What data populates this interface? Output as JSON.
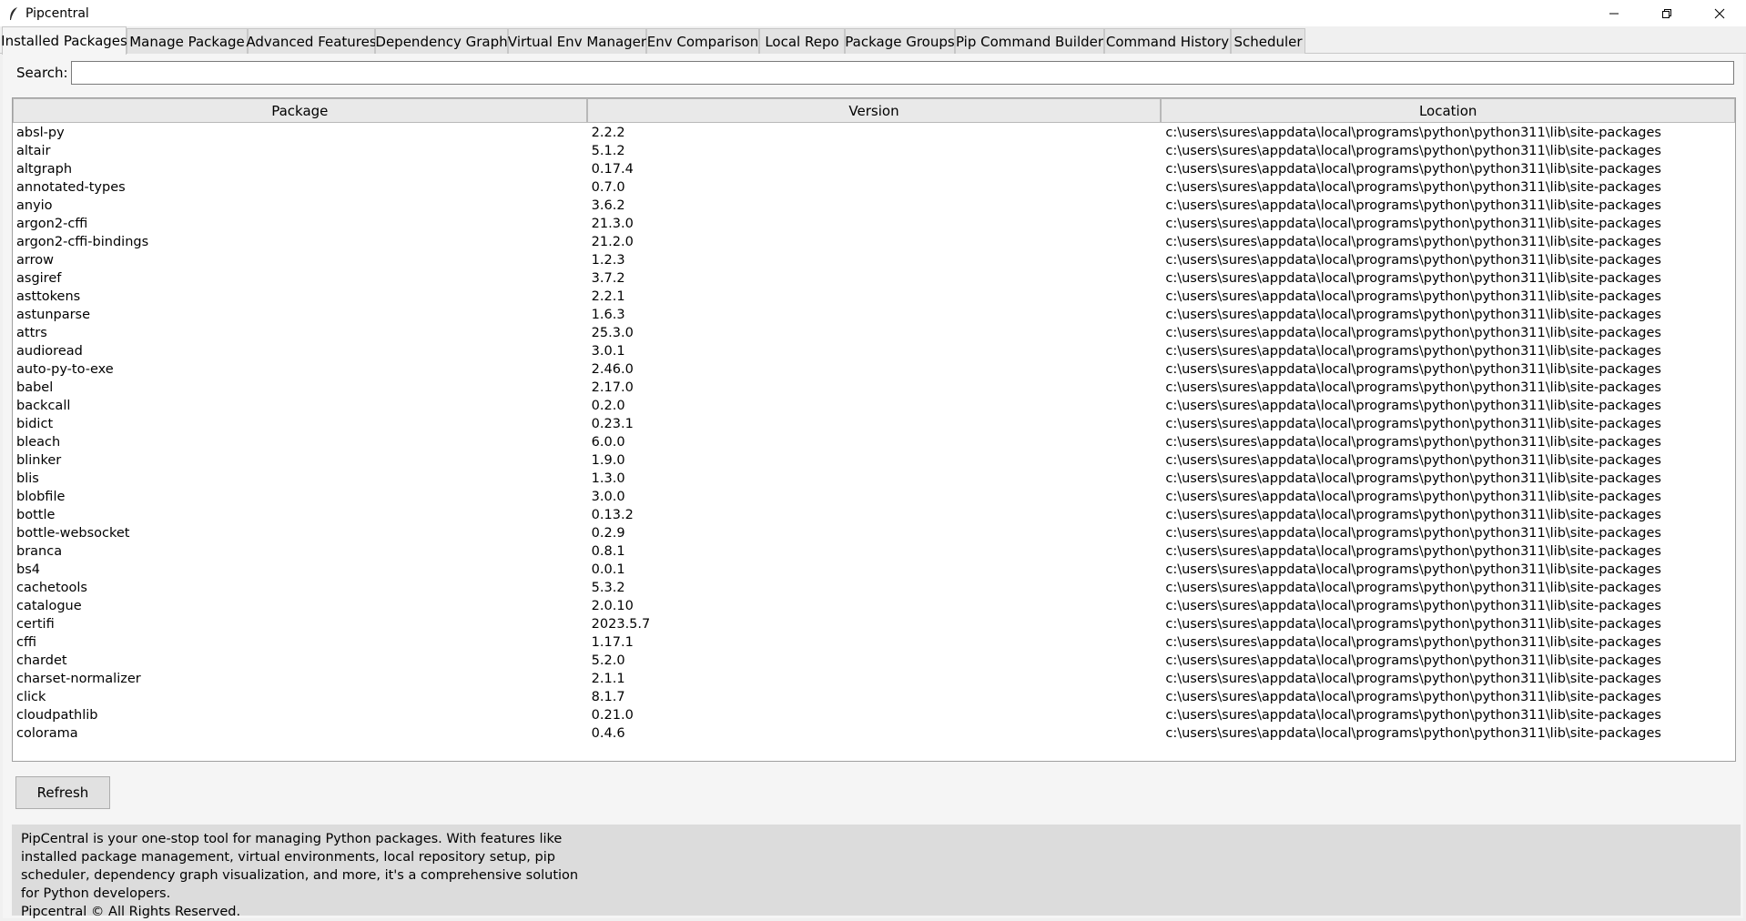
{
  "window": {
    "title": "Pipcentral",
    "controls": [
      "minimize-icon",
      "restore-icon",
      "close-icon"
    ]
  },
  "tabs": [
    {
      "label": "Installed Packages",
      "active": true
    },
    {
      "label": "Manage Package"
    },
    {
      "label": "Advanced Features"
    },
    {
      "label": "Dependency Graph"
    },
    {
      "label": "Virtual Env Manager"
    },
    {
      "label": "Env Comparison"
    },
    {
      "label": "Local Repo"
    },
    {
      "label": "Package Groups"
    },
    {
      "label": "Pip Command Builder"
    },
    {
      "label": "Command History"
    },
    {
      "label": "Scheduler"
    }
  ],
  "search": {
    "label": "Search:",
    "value": "",
    "placeholder": ""
  },
  "table": {
    "columns": [
      "Package",
      "Version",
      "Location"
    ],
    "rows": [
      [
        "absl-py",
        "2.2.2",
        "c:\\users\\sures\\appdata\\local\\programs\\python\\python311\\lib\\site-packages"
      ],
      [
        "altair",
        "5.1.2",
        "c:\\users\\sures\\appdata\\local\\programs\\python\\python311\\lib\\site-packages"
      ],
      [
        "altgraph",
        "0.17.4",
        "c:\\users\\sures\\appdata\\local\\programs\\python\\python311\\lib\\site-packages"
      ],
      [
        "annotated-types",
        "0.7.0",
        "c:\\users\\sures\\appdata\\local\\programs\\python\\python311\\lib\\site-packages"
      ],
      [
        "anyio",
        "3.6.2",
        "c:\\users\\sures\\appdata\\local\\programs\\python\\python311\\lib\\site-packages"
      ],
      [
        "argon2-cffi",
        "21.3.0",
        "c:\\users\\sures\\appdata\\local\\programs\\python\\python311\\lib\\site-packages"
      ],
      [
        "argon2-cffi-bindings",
        "21.2.0",
        "c:\\users\\sures\\appdata\\local\\programs\\python\\python311\\lib\\site-packages"
      ],
      [
        "arrow",
        "1.2.3",
        "c:\\users\\sures\\appdata\\local\\programs\\python\\python311\\lib\\site-packages"
      ],
      [
        "asgiref",
        "3.7.2",
        "c:\\users\\sures\\appdata\\local\\programs\\python\\python311\\lib\\site-packages"
      ],
      [
        "asttokens",
        "2.2.1",
        "c:\\users\\sures\\appdata\\local\\programs\\python\\python311\\lib\\site-packages"
      ],
      [
        "astunparse",
        "1.6.3",
        "c:\\users\\sures\\appdata\\local\\programs\\python\\python311\\lib\\site-packages"
      ],
      [
        "attrs",
        "25.3.0",
        "c:\\users\\sures\\appdata\\local\\programs\\python\\python311\\lib\\site-packages"
      ],
      [
        "audioread",
        "3.0.1",
        "c:\\users\\sures\\appdata\\local\\programs\\python\\python311\\lib\\site-packages"
      ],
      [
        "auto-py-to-exe",
        "2.46.0",
        "c:\\users\\sures\\appdata\\local\\programs\\python\\python311\\lib\\site-packages"
      ],
      [
        "babel",
        "2.17.0",
        "c:\\users\\sures\\appdata\\local\\programs\\python\\python311\\lib\\site-packages"
      ],
      [
        "backcall",
        "0.2.0",
        "c:\\users\\sures\\appdata\\local\\programs\\python\\python311\\lib\\site-packages"
      ],
      [
        "bidict",
        "0.23.1",
        "c:\\users\\sures\\appdata\\local\\programs\\python\\python311\\lib\\site-packages"
      ],
      [
        "bleach",
        "6.0.0",
        "c:\\users\\sures\\appdata\\local\\programs\\python\\python311\\lib\\site-packages"
      ],
      [
        "blinker",
        "1.9.0",
        "c:\\users\\sures\\appdata\\local\\programs\\python\\python311\\lib\\site-packages"
      ],
      [
        "blis",
        "1.3.0",
        "c:\\users\\sures\\appdata\\local\\programs\\python\\python311\\lib\\site-packages"
      ],
      [
        "blobfile",
        "3.0.0",
        "c:\\users\\sures\\appdata\\local\\programs\\python\\python311\\lib\\site-packages"
      ],
      [
        "bottle",
        "0.13.2",
        "c:\\users\\sures\\appdata\\local\\programs\\python\\python311\\lib\\site-packages"
      ],
      [
        "bottle-websocket",
        "0.2.9",
        "c:\\users\\sures\\appdata\\local\\programs\\python\\python311\\lib\\site-packages"
      ],
      [
        "branca",
        "0.8.1",
        "c:\\users\\sures\\appdata\\local\\programs\\python\\python311\\lib\\site-packages"
      ],
      [
        "bs4",
        "0.0.1",
        "c:\\users\\sures\\appdata\\local\\programs\\python\\python311\\lib\\site-packages"
      ],
      [
        "cachetools",
        "5.3.2",
        "c:\\users\\sures\\appdata\\local\\programs\\python\\python311\\lib\\site-packages"
      ],
      [
        "catalogue",
        "2.0.10",
        "c:\\users\\sures\\appdata\\local\\programs\\python\\python311\\lib\\site-packages"
      ],
      [
        "certifi",
        "2023.5.7",
        "c:\\users\\sures\\appdata\\local\\programs\\python\\python311\\lib\\site-packages"
      ],
      [
        "cffi",
        "1.17.1",
        "c:\\users\\sures\\appdata\\local\\programs\\python\\python311\\lib\\site-packages"
      ],
      [
        "chardet",
        "5.2.0",
        "c:\\users\\sures\\appdata\\local\\programs\\python\\python311\\lib\\site-packages"
      ],
      [
        "charset-normalizer",
        "2.1.1",
        "c:\\users\\sures\\appdata\\local\\programs\\python\\python311\\lib\\site-packages"
      ],
      [
        "click",
        "8.1.7",
        "c:\\users\\sures\\appdata\\local\\programs\\python\\python311\\lib\\site-packages"
      ],
      [
        "cloudpathlib",
        "0.21.0",
        "c:\\users\\sures\\appdata\\local\\programs\\python\\python311\\lib\\site-packages"
      ],
      [
        "colorama",
        "0.4.6",
        "c:\\users\\sures\\appdata\\local\\programs\\python\\python311\\lib\\site-packages"
      ]
    ]
  },
  "refresh_label": "Refresh",
  "footer": {
    "description": "PipCentral is your one-stop tool for managing Python packages. With features like installed package management, virtual environments, local repository setup, pip scheduler, dependency graph visualization, and more, it's a comprehensive solution for Python developers.",
    "copyright": "Pipcentral © All Rights Reserved."
  }
}
